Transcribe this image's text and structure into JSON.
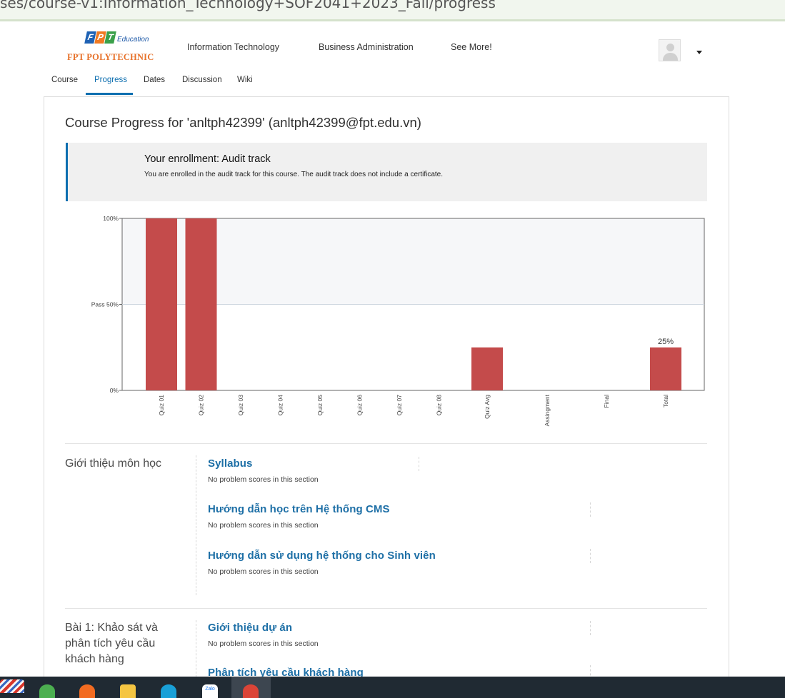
{
  "browser": {
    "url_text": "ses/course-v1:Information_Technology+SOF2041+2023_Fall/progress"
  },
  "header": {
    "logo": {
      "letters": [
        "F",
        "P",
        "T"
      ],
      "education": "Education",
      "name": "FPT POLYTECHNIC"
    },
    "nav": [
      "Information Technology",
      "Business Administration",
      "See More!"
    ]
  },
  "tabs": [
    "Course",
    "Progress",
    "Dates",
    "Discussion",
    "Wiki"
  ],
  "page": {
    "title": "Course Progress for 'anltph42399' (anltph42399@fpt.edu.vn)"
  },
  "enrollment": {
    "heading": "Your enrollment: Audit track",
    "text": "You are enrolled in the audit track for this course. The audit track does not include a certificate."
  },
  "chart_data": {
    "type": "bar",
    "categories": [
      "Quiz 01",
      "Quiz 02",
      "Quiz 03",
      "Quiz 04",
      "Quiz 05",
      "Quiz 06",
      "Quiz 07",
      "Quiz 08",
      "Quiz Avg",
      "Assingment",
      "Final",
      "Total"
    ],
    "values": [
      100,
      100,
      0,
      0,
      0,
      0,
      0,
      0,
      25,
      0,
      0,
      25
    ],
    "ylim": [
      0,
      100
    ],
    "y_ticks": [
      {
        "value": 100,
        "label": "100%"
      },
      {
        "value": 50,
        "label": "Pass 50%"
      },
      {
        "value": 0,
        "label": "0%"
      }
    ],
    "pass_value": 50,
    "data_labels": [
      {
        "category": "Total",
        "label": "25%"
      }
    ],
    "bar_color": "#c44b4b"
  },
  "sections": [
    {
      "chapter": "Giới thiệu môn học",
      "subsections": [
        {
          "name": "Syllabus",
          "note": "No problem scores in this section"
        },
        {
          "name": "Hướng dẫn học trên Hệ thống CMS",
          "note": "No problem scores in this section"
        },
        {
          "name": "Hướng dẫn sử dụng hệ thống cho Sinh viên",
          "note": "No problem scores in this section"
        }
      ]
    },
    {
      "chapter": "Bài 1: Khảo sát và phân tích yêu cầu khách hàng",
      "subsections": [
        {
          "name": "Giới thiệu dự án",
          "note": "No problem scores in this section"
        },
        {
          "name": "Phân tích yêu cầu khách hàng",
          "note": ""
        }
      ]
    }
  ],
  "taskbar": {
    "zalo": "Zalo"
  }
}
